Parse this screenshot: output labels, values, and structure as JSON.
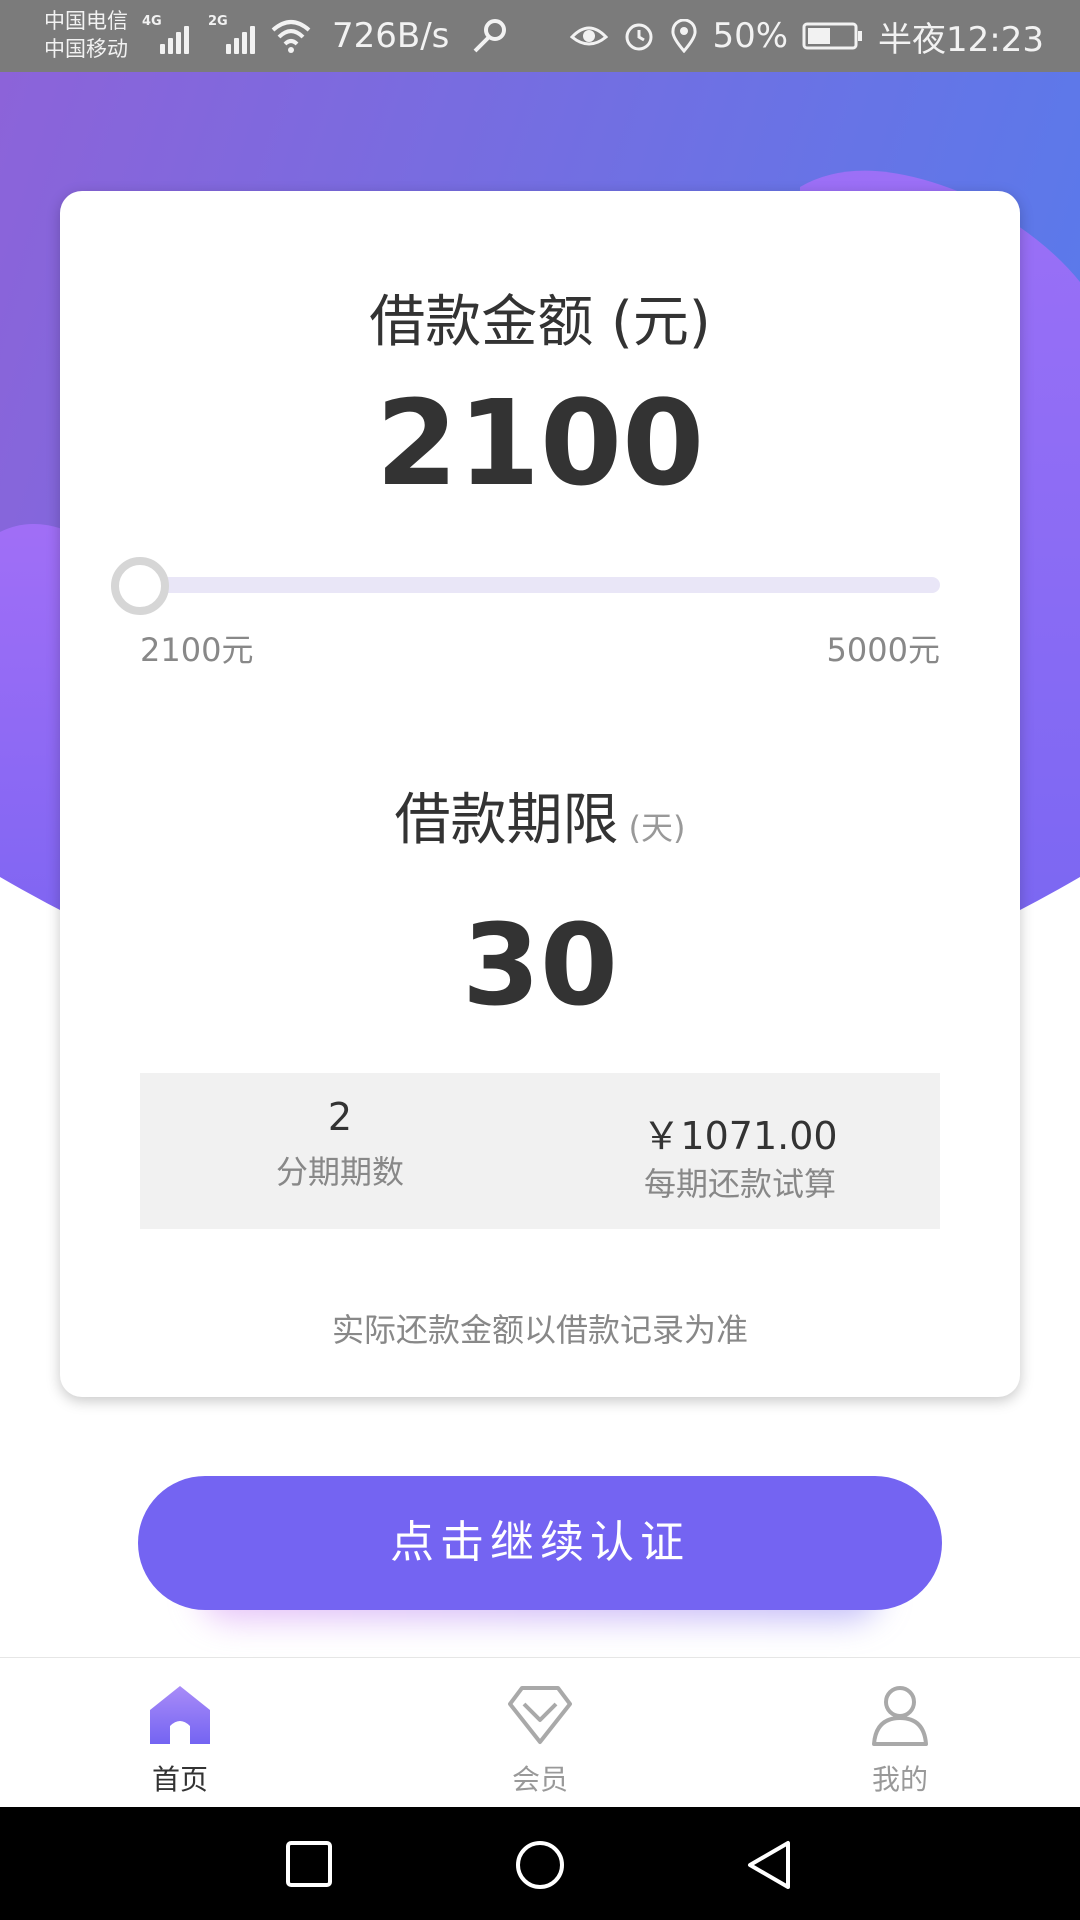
{
  "status_bar": {
    "carrier_1": "中国电信",
    "carrier_2": "中国移动",
    "network_1": "4G",
    "network_2": "2G",
    "speed": "726B/s",
    "battery": "50%",
    "time": "半夜12:23",
    "icons": [
      "signal-icon",
      "wifi-icon",
      "key-icon",
      "eye-icon",
      "alarm-icon",
      "location-icon",
      "battery-icon"
    ]
  },
  "loan": {
    "amount_title": "借款金额 (元)",
    "amount_value": "2100",
    "slider": {
      "min_label": "2100元",
      "max_label": "5000元",
      "level": 0.0
    },
    "term_title": "借款期限",
    "term_unit": "(天)",
    "term_value": "30",
    "installments_value": "2",
    "installments_label": "分期期数",
    "repayment_value": "￥1071.00",
    "repayment_label": "每期还款试算",
    "disclaimer": "实际还款金额以借款记录为准"
  },
  "cta": {
    "label": "点击继续认证"
  },
  "tabs": [
    {
      "label": "首页",
      "icon": "home-icon",
      "active": true
    },
    {
      "label": "会员",
      "icon": "diamond-icon",
      "active": false
    },
    {
      "label": "我的",
      "icon": "user-icon",
      "active": false
    }
  ],
  "colors": {
    "accent": "#7464f2",
    "gradient_start": "#8c63d9",
    "gradient_end": "#5b79ea",
    "blob": "#9c6cf7"
  }
}
